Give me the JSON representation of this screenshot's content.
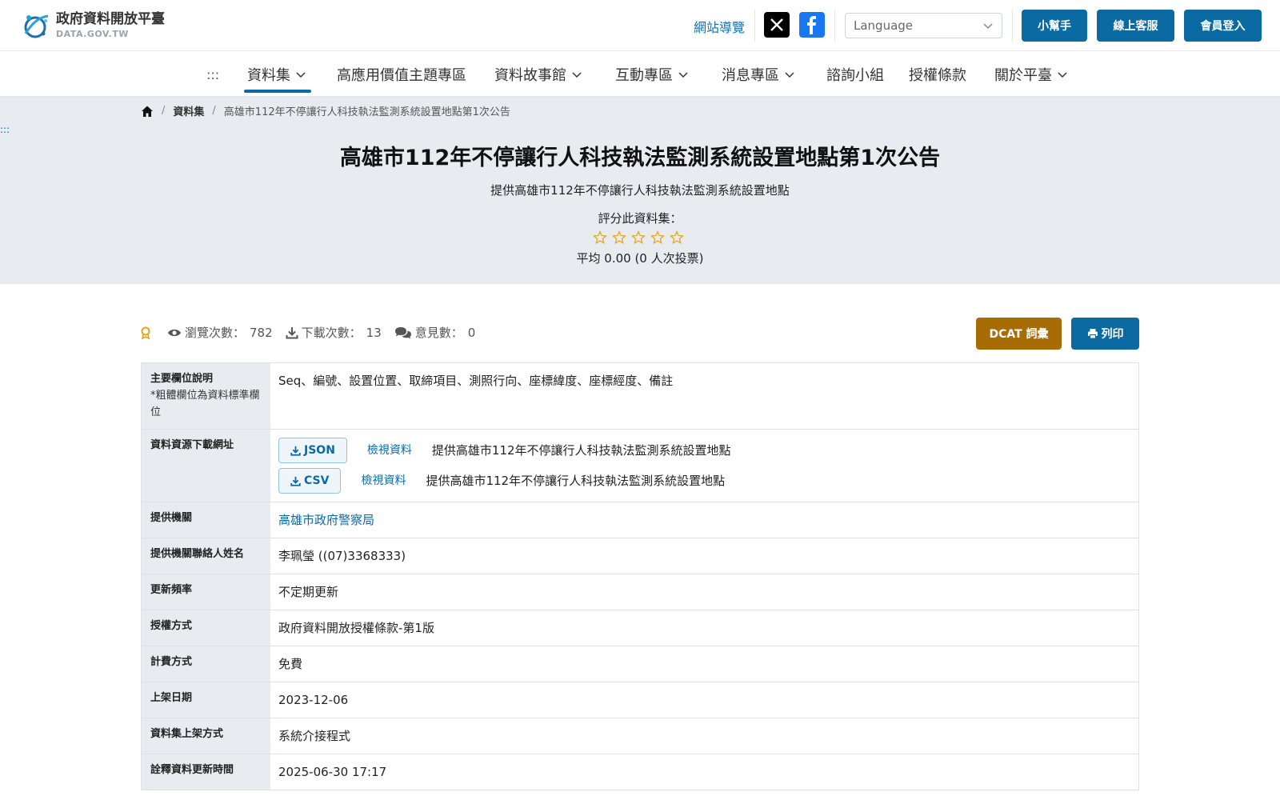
{
  "header": {
    "logo_title": "政府資料開放平臺",
    "logo_sub": "DATA.GOV.TW",
    "sitemap": "網站導覽",
    "language_placeholder": "Language",
    "help": "小幫手",
    "service": "線上客服",
    "login": "會員登入"
  },
  "nav": {
    "dots": ":::",
    "items": [
      {
        "label": "資料集"
      },
      {
        "label": "高應用價值主題專區"
      },
      {
        "label": "資料故事館"
      },
      {
        "label": "互動專區"
      },
      {
        "label": "消息專區"
      },
      {
        "label": "諮詢小組"
      },
      {
        "label": "授權條款"
      },
      {
        "label": "關於平臺"
      }
    ]
  },
  "breadcrumb": {
    "section": "資料集",
    "current": "高雄市112年不停讓行人科技執法監測系統設置地點第1次公告"
  },
  "side_dots": ":::",
  "dataset": {
    "title": "高雄市112年不停讓行人科技執法監測系統設置地點第1次公告",
    "description": "提供高雄市112年不停讓行人科技執法監測系統設置地點",
    "rate_label": "評分此資料集：",
    "rating_stars": 0,
    "rating_avg": "平均 0.00 (0 人次投票)"
  },
  "stats": {
    "views_label": "瀏覽次數：",
    "views": "782",
    "downloads_label": "下載次數：",
    "downloads": "13",
    "comments_label": "意見數：",
    "comments": "0"
  },
  "actions": {
    "dcat": "DCAT 詞彙",
    "print": "列印"
  },
  "details": {
    "main_fields_label": "主要欄位說明",
    "main_fields_note": "*粗體欄位為資料標準欄位",
    "main_fields": "Seq、編號、設置位置、取締項目、測照行向、座標緯度、座標經度、備註",
    "resources_label": "資料資源下載網址",
    "resources": [
      {
        "format": "JSON",
        "view": "檢視資料",
        "desc": "提供高雄市112年不停讓行人科技執法監測系統設置地點"
      },
      {
        "format": "CSV",
        "view": "檢視資料",
        "desc": "提供高雄市112年不停讓行人科技執法監測系統設置地點"
      }
    ],
    "provider_label": "提供機關",
    "provider": "高雄市政府警察局",
    "contact_label": "提供機關聯絡人姓名",
    "contact": "李珮瑩 ((07)3368333)",
    "frequency_label": "更新頻率",
    "frequency": "不定期更新",
    "license_label": "授權方式",
    "license": "政府資料開放授權條款-第1版",
    "fee_label": "計費方式",
    "fee": "免費",
    "published_label": "上架日期",
    "published": "2023-12-06",
    "method_label": "資料集上架方式",
    "method": "系統介接程式",
    "meta_updated_label": "詮釋資料更新時間",
    "meta_updated": "2025-06-30 17:17"
  },
  "colors": {
    "primary": "#0b6aa2",
    "dcat": "#a86c07",
    "hero_bg": "#e8ecf1",
    "star": "#e8a317"
  }
}
